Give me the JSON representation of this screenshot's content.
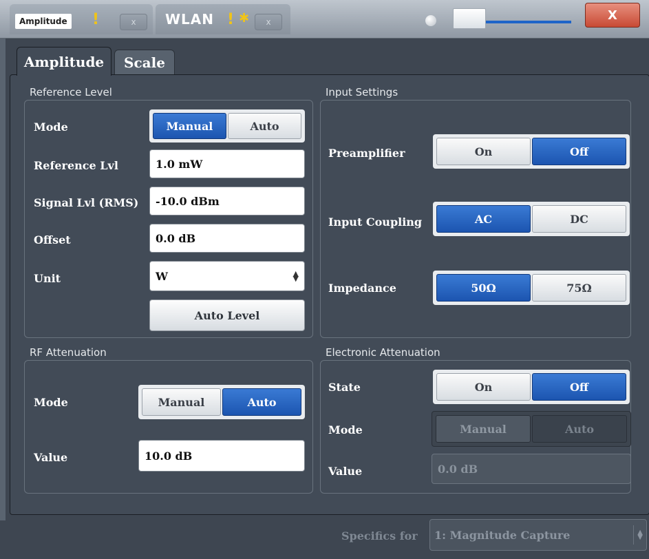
{
  "titlebar": {
    "tab1_name": "Amplitude",
    "tab1_warning": "!",
    "tab2_name": "WLAN",
    "tab2_warning": "!",
    "tab2_star": "✱",
    "close_tab_label": "x",
    "close_window_label": "X"
  },
  "dialog_tabs": [
    "Amplitude",
    "Scale"
  ],
  "reference_level": {
    "title": "Reference Level",
    "mode_label": "Mode",
    "mode_options": [
      "Manual",
      "Auto"
    ],
    "mode_selected": "Manual",
    "ref_lvl_label": "Reference Lvl",
    "ref_lvl_value": "1.0 mW",
    "signal_lvl_label": "Signal Lvl (RMS)",
    "signal_lvl_value": "-10.0 dBm",
    "offset_label": "Offset",
    "offset_value": "0.0 dB",
    "unit_label": "Unit",
    "unit_value": "W",
    "auto_level_label": "Auto Level"
  },
  "input_settings": {
    "title": "Input Settings",
    "preamp_label": "Preamplifier",
    "preamp_options": [
      "On",
      "Off"
    ],
    "preamp_selected": "Off",
    "coupling_label": "Input Coupling",
    "coupling_options": [
      "AC",
      "DC"
    ],
    "coupling_selected": "AC",
    "impedance_label": "Impedance",
    "impedance_options": [
      "50Ω",
      "75Ω"
    ],
    "impedance_selected": "50Ω"
  },
  "rf_attenuation": {
    "title": "RF Attenuation",
    "mode_label": "Mode",
    "mode_options": [
      "Manual",
      "Auto"
    ],
    "mode_selected": "Auto",
    "value_label": "Value",
    "value": "10.0 dB"
  },
  "electronic_attenuation": {
    "title": "Electronic Attenuation",
    "state_label": "State",
    "state_options": [
      "On",
      "Off"
    ],
    "state_selected": "Off",
    "mode_label": "Mode",
    "mode_options": [
      "Manual",
      "Auto"
    ],
    "mode_selected": "Auto",
    "value_label": "Value",
    "value": "0.0 dB"
  },
  "footer": {
    "specifics_label": "Specifics for",
    "specifics_value": "1: Magnitude Capture"
  },
  "colors": {
    "accent": "#1c55b0",
    "background": "#424b57",
    "close_button": "#c84a35"
  },
  "icons": [
    "warning-icon",
    "star-icon",
    "close-icon",
    "status-indicator-icon",
    "select-arrows-icon"
  ]
}
